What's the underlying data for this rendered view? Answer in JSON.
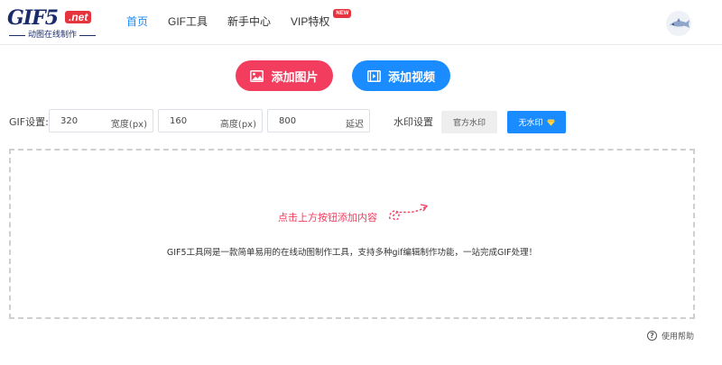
{
  "logo": {
    "main": "GIF5",
    "badge": ".net",
    "tagline": "动图在线制作"
  },
  "nav": {
    "items": [
      {
        "label": "首页",
        "active": true
      },
      {
        "label": "GIF工具",
        "active": false
      },
      {
        "label": "新手中心",
        "active": false
      },
      {
        "label": "VIP特权",
        "active": false
      }
    ],
    "vip_badge": "NEW"
  },
  "upload": {
    "add_image_label": "添加图片",
    "add_video_label": "添加视频"
  },
  "settings": {
    "label": "GIF设置:",
    "width_value": "320",
    "width_unit": "宽度(px)",
    "height_value": "160",
    "height_unit": "高度(px)",
    "delay_value": "800",
    "delay_unit": "延迟",
    "watermark_label": "水印设置",
    "official_watermark_label": "官方水印",
    "no_watermark_label": "无水印"
  },
  "dropzone": {
    "hint": "点击上方按钮添加内容",
    "description": "GIF5工具网是一款简单易用的在线动图制作工具，支持多种gif编辑制作功能，一站完成GIF处理！"
  },
  "help": {
    "label": "使用帮助"
  },
  "colors": {
    "brand_navy": "#1b2c6b",
    "accent_red": "#f23d5e",
    "accent_blue": "#1a8cff"
  }
}
